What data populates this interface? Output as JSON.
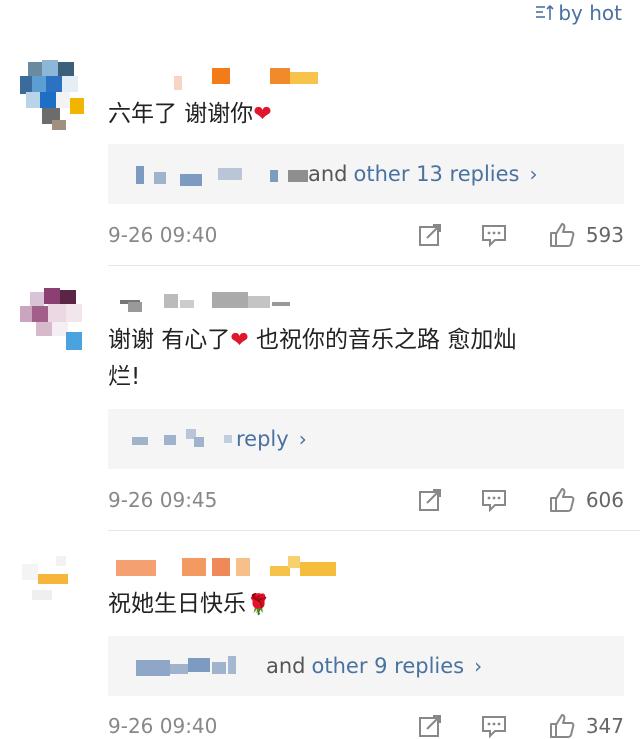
{
  "sort": {
    "label": "by hot"
  },
  "comments": [
    {
      "text": "六年了 谢谢你",
      "emoji": "❤",
      "replies_prefix": "and",
      "replies_more": "other 13 replies",
      "time": "9-26 09:40",
      "likes": "593"
    },
    {
      "text_line1": "谢谢 有心了",
      "emoji": "❤",
      "text_line1_after": " 也祝你的音乐之路 愈加灿",
      "text_line2": "烂!",
      "replies_prefix": "",
      "replies_more": "reply",
      "time": "9-26 09:45",
      "likes": "606"
    },
    {
      "text": "祝她生日快乐",
      "emoji": "🌹",
      "replies_prefix": "and",
      "replies_more": "other 9 replies",
      "time": "9-26 09:40",
      "likes": "347"
    }
  ],
  "icons": {
    "sort": "sort-icon",
    "repost": "repost-icon",
    "comment": "comment-icon",
    "like": "thumbs-up-icon",
    "chevron": "chevron-right-icon"
  },
  "colors": {
    "link": "#4a72a0",
    "heart": "#e0162b",
    "meta": "#888888",
    "reply_bg": "#f5f5f5"
  }
}
